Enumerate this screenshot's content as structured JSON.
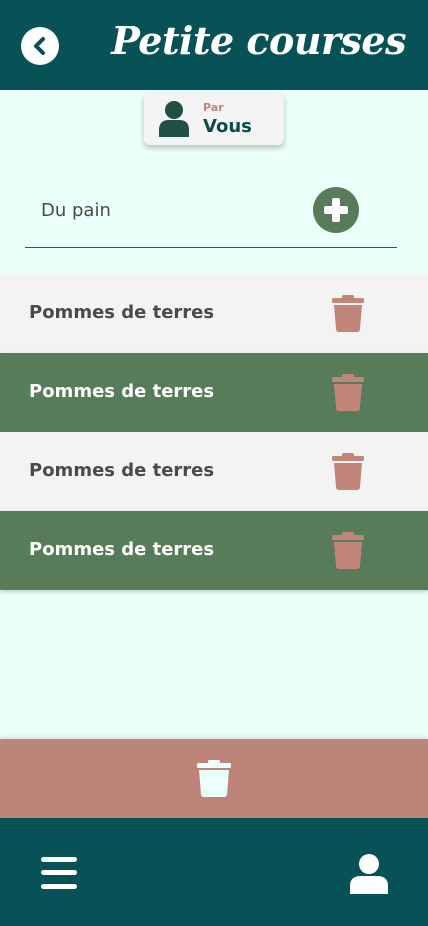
{
  "header": {
    "title": "Petite courses",
    "back_icon": "chevron-left-circle-icon"
  },
  "author": {
    "prefix": "Par",
    "name": "Vous",
    "icon": "user-icon"
  },
  "new_item": {
    "value": "Du pain",
    "add_icon": "plus-circle-icon"
  },
  "items": [
    {
      "label": "Pommes de terres",
      "style": "light",
      "delete_icon": "trash-icon"
    },
    {
      "label": "Pommes de terres",
      "style": "dark",
      "delete_icon": "trash-icon"
    },
    {
      "label": "Pommes de terres",
      "style": "light",
      "delete_icon": "trash-icon"
    },
    {
      "label": "Pommes de terres",
      "style": "dark",
      "delete_icon": "trash-icon"
    }
  ],
  "clear_all": {
    "icon": "trash-icon"
  },
  "bottom_nav": {
    "menu_icon": "hamburger-menu-icon",
    "profile_icon": "user-icon"
  },
  "colors": {
    "primary": "#075256",
    "background": "#ebfffb",
    "accent_green": "#587c5a",
    "accent_rose": "#bd857a",
    "row_light": "#f3f3f3"
  }
}
